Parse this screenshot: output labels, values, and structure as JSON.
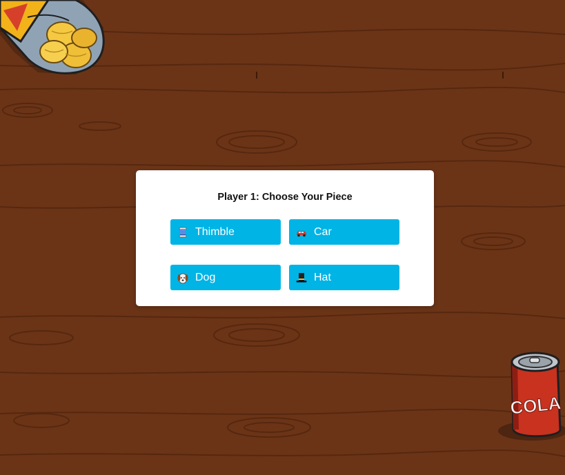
{
  "background": {
    "wood_color": "#6b3417",
    "grain_color": "#4e230c",
    "decorations": [
      "chips-bag",
      "cola-can"
    ],
    "cola_label": "COLA"
  },
  "modal": {
    "title": "Player 1: Choose Your Piece",
    "button_color": "#00b4e6",
    "pieces": [
      {
        "label": "Thimble",
        "icon": "thimble-icon"
      },
      {
        "label": "Car",
        "icon": "car-icon"
      },
      {
        "label": "Dog",
        "icon": "dog-icon"
      },
      {
        "label": "Hat",
        "icon": "top-hat-icon"
      }
    ]
  }
}
